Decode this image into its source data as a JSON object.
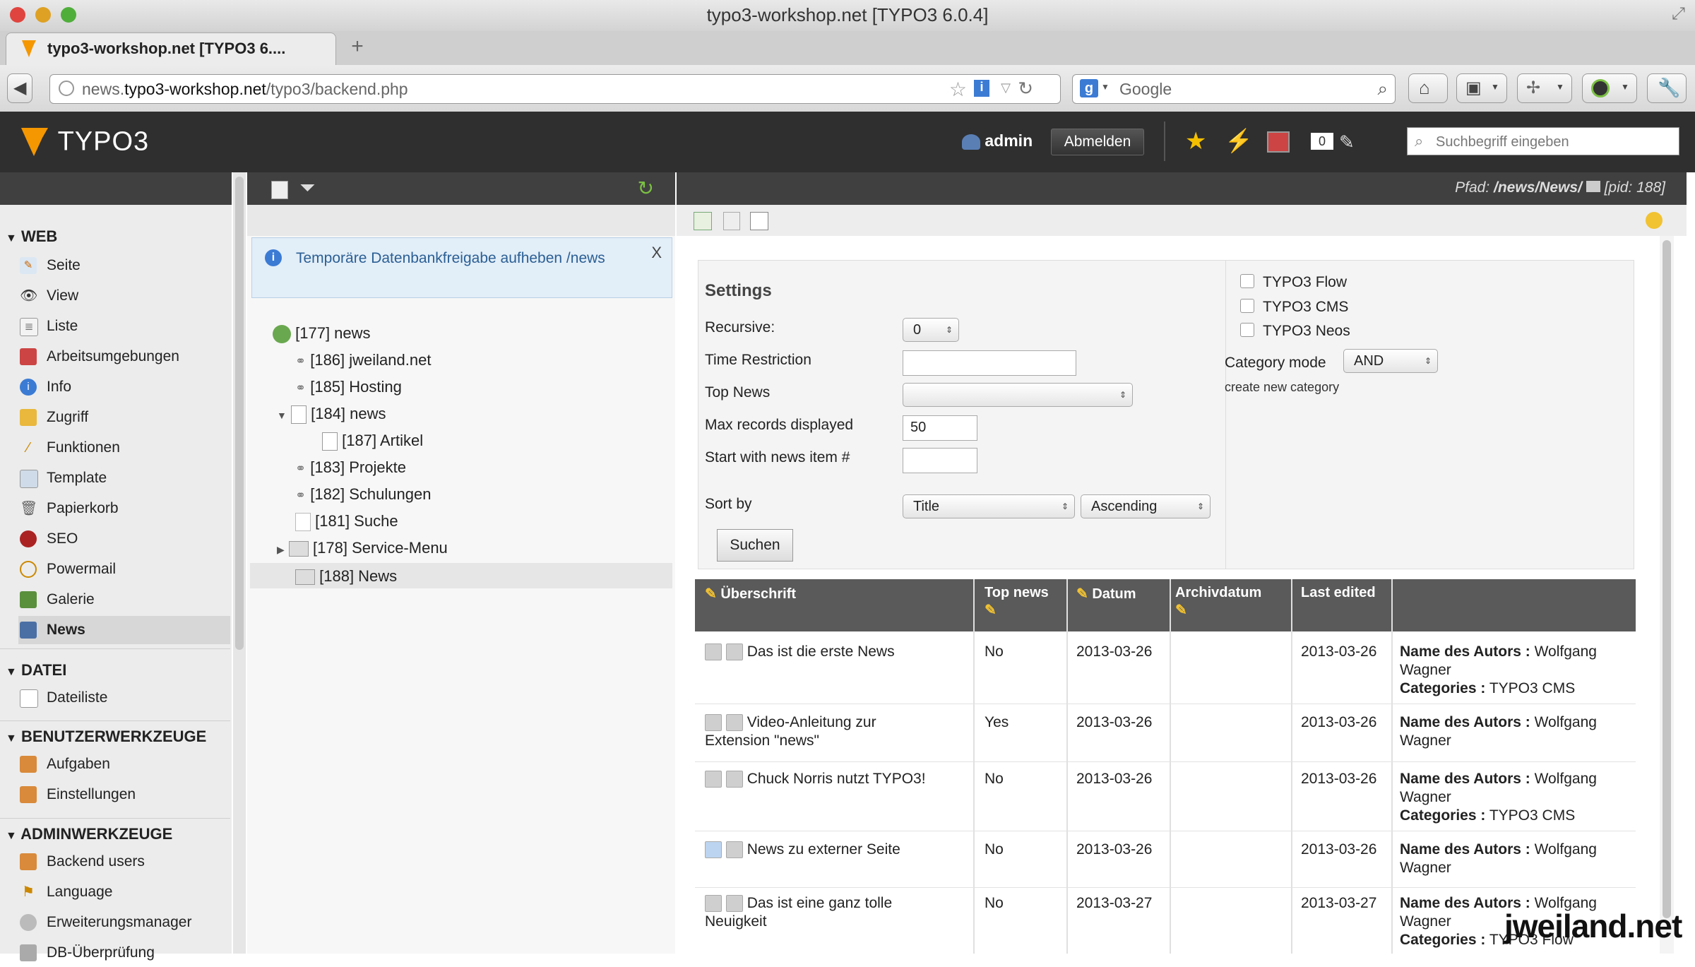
{
  "browser": {
    "window_title": "typo3-workshop.net [TYPO3 6.0.4]",
    "tab_title": "typo3-workshop.net [TYPO3 6....",
    "new_tab": "+",
    "url_prefix": "news.",
    "url_host": "typo3-workshop.net",
    "url_path": "/typo3/backend.php",
    "search_engine": "Google"
  },
  "header": {
    "logo": "TYPO3",
    "user": "admin",
    "logout_label": "Abmelden",
    "counter": "0",
    "search_placeholder": "Suchbegriff eingeben"
  },
  "menu": {
    "groups": [
      {
        "title": "WEB",
        "items": [
          "Seite",
          "View",
          "Liste",
          "Arbeitsumgebungen",
          "Info",
          "Zugriff",
          "Funktionen",
          "Template",
          "Papierkorb",
          "SEO",
          "Powermail",
          "Galerie",
          "News"
        ]
      },
      {
        "title": "DATEI",
        "items": [
          "Dateiliste"
        ]
      },
      {
        "title": "BENUTZERWERKZEUGE",
        "items": [
          "Aufgaben",
          "Einstellungen"
        ]
      },
      {
        "title": "ADMINWERKZEUGE",
        "items": [
          "Backend users",
          "Language",
          "Erweiterungsmanager",
          "DB-Überprüfung"
        ]
      }
    ],
    "active_item": "News"
  },
  "tree": {
    "info_message": "Temporäre Datenbankfreigabe aufheben /news",
    "close_label": "X",
    "nodes": [
      "[177] news",
      "[186] jweiland.net",
      "[185] Hosting",
      "[184] news",
      "[187] Artikel",
      "[183] Projekte",
      "[182] Schulungen",
      "[181] Suche",
      "[178] Service-Menu",
      "[188] News"
    ]
  },
  "content": {
    "path_label": "Pfad:",
    "path_value": "/news/News/",
    "pid": "[pid: 188]",
    "settings": {
      "title": "Settings",
      "recursive_label": "Recursive:",
      "recursive_value": "0",
      "time_restriction_label": "Time Restriction",
      "time_restriction_value": "",
      "top_news_label": "Top News",
      "top_news_value": "",
      "max_records_label": "Max records displayed",
      "max_records_value": "50",
      "start_with_label": "Start with news item #",
      "start_with_value": "",
      "sort_by_label": "Sort by",
      "sort_by_value": "Title",
      "sort_order_value": "Ascending",
      "submit_label": "Suchen",
      "categories": [
        {
          "label": "TYPO3 Flow",
          "checked": false
        },
        {
          "label": "TYPO3 CMS",
          "checked": false
        },
        {
          "label": "TYPO3 Neos",
          "checked": false
        }
      ],
      "category_mode_label": "Category mode",
      "category_mode_value": "AND",
      "create_category_label": "create new category"
    },
    "table": {
      "headers": [
        "Überschrift",
        "Top news",
        "Datum",
        "Archivdatum",
        "Last edited"
      ],
      "rows": [
        {
          "title": "Das ist die erste News",
          "top": "No",
          "date": "2013-03-26",
          "archive": "",
          "edited": "2013-03-26",
          "author_label": "Name des Autors :",
          "author": "Wolfgang Wagner",
          "cat_label": "Categories :",
          "cats": "TYPO3 CMS"
        },
        {
          "title": "Video-Anleitung zur Extension \"news\"",
          "top": "Yes",
          "date": "2013-03-26",
          "archive": "",
          "edited": "2013-03-26",
          "author_label": "Name des Autors :",
          "author": "Wolfgang Wagner",
          "cat_label": "",
          "cats": ""
        },
        {
          "title": "Chuck Norris nutzt TYPO3!",
          "top": "No",
          "date": "2013-03-26",
          "archive": "",
          "edited": "2013-03-26",
          "author_label": "Name des Autors :",
          "author": "Wolfgang Wagner",
          "cat_label": "Categories :",
          "cats": "TYPO3 CMS"
        },
        {
          "title": "News zu externer Seite",
          "top": "No",
          "date": "2013-03-26",
          "archive": "",
          "edited": "2013-03-26",
          "author_label": "Name des Autors :",
          "author": "Wolfgang Wagner",
          "cat_label": "",
          "cats": ""
        },
        {
          "title": "Das ist eine ganz tolle Neuigkeit",
          "top": "No",
          "date": "2013-03-27",
          "archive": "",
          "edited": "2013-03-27",
          "author_label": "Name des Autors :",
          "author": "Wolfgang Wagner",
          "cat_label": "Categories :",
          "cats": "TYPO3 Flow"
        }
      ]
    }
  },
  "watermark": "jweiland.net",
  "colors": {
    "typo3_orange": "#f49700",
    "header_dark": "#2f2f2f",
    "info_blue": "#2b5f94"
  }
}
